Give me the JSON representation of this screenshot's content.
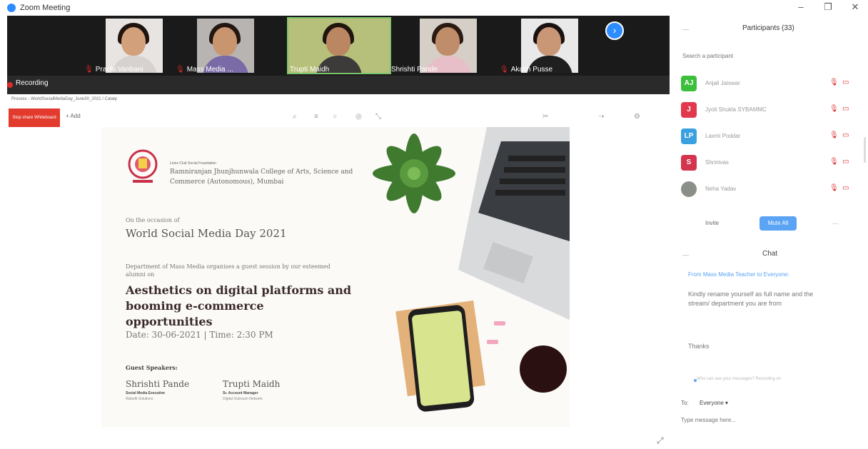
{
  "window": {
    "title": "Zoom Meeting",
    "controls": {
      "minimize": "–",
      "restore": "❐",
      "close": "✕"
    }
  },
  "gallery": {
    "participants": [
      {
        "name": "Prachi Vanbani",
        "shirt": "#d7d2cf",
        "bg": "#e8e4e1",
        "hair": "#1f140e",
        "skin": "#d3a07c",
        "active": false
      },
      {
        "name": "Mass Media ...",
        "shirt": "#7a6aa6",
        "bg": "#b7b4b2",
        "hair": "#241711",
        "skin": "#c9956f",
        "active": false
      },
      {
        "name": "Trupti Maidh",
        "shirt": "#3d3a3a",
        "bg": "#b7c07a",
        "hair": "#1f140e",
        "skin": "#bb8763",
        "active": true
      },
      {
        "name": "Shrishti Pande",
        "shirt": "#e7bfc8",
        "bg": "#d6cfc8",
        "hair": "#2a1a12",
        "skin": "#c08d6b",
        "active": false
      },
      {
        "name": "Akash Pusse",
        "shirt": "#1f1f1f",
        "bg": "#e9e9e9",
        "hair": "#1a1210",
        "skin": "#c99775",
        "active": false
      }
    ],
    "next_icon": "›"
  },
  "recording": {
    "label": "Recording",
    "file": "Process - WorldSocialMediaDay_June30_2021 / Catalp"
  },
  "share_toolbar": {
    "share_label": "Stop share Whiteboard",
    "add_label": "+ Add"
  },
  "slide": {
    "tagline": "Lions Club Social Foundation",
    "college": "Ramniranjan Jhunjhunwala College of Arts, Science and Commerce (Autonomous), Mumbai",
    "occasion": "On the occasion of",
    "event": "World Social Media Day 2021",
    "dept": "Department of Mass Media organises a guest session by our esteemed alumni on",
    "headline": "Aesthetics on digital platforms and booming e-commerce opportunities",
    "datetime": "Date: 30-06-2021 | Time: 2:30 PM",
    "speakers_label": "Guest Speakers:",
    "speakers": [
      {
        "name": "Shrishti Pande",
        "role": "Social Media Executive",
        "org": "Wakefit Solutions"
      },
      {
        "name": "Trupti Maidh",
        "role": "Sr. Account Manager",
        "org": "Digital Outreach Network"
      }
    ]
  },
  "participants_panel": {
    "title": "Participants (33)",
    "search_placeholder": "Search a participant",
    "list": [
      {
        "initials": "AJ",
        "name": "Anjali Jaiswar",
        "color": "#3cbf3c"
      },
      {
        "initials": "J",
        "name": "Jyoti Shukla SYBAMMC",
        "color": "#e2384e"
      },
      {
        "initials": "LP",
        "name": "Laxmi Poddar",
        "color": "#3aa0e0"
      },
      {
        "initials": "S",
        "name": "Shrinivas",
        "color": "#d3344e"
      },
      {
        "initials": "",
        "name": "Neha Yadav",
        "color": "#8a8f88"
      }
    ],
    "invite_label": "Invite",
    "mute_all_label": "Mute All",
    "more_label": "..."
  },
  "chat": {
    "title": "Chat",
    "from": "From Mass Media Teacher to Everyone:",
    "message": "Kindly rename yourself as full name and the stream/ department you are from",
    "thanks": "Thanks",
    "hint": "Who can see your messages? Recording on",
    "to_label": "To:",
    "to_value": "Everyone ▾",
    "input_placeholder": "Type message here..."
  },
  "colors": {
    "accent": "#2d8cff",
    "recording_red": "#e02828",
    "share_red": "#e23b2e",
    "mute_all_blue": "#5aa3f5"
  }
}
